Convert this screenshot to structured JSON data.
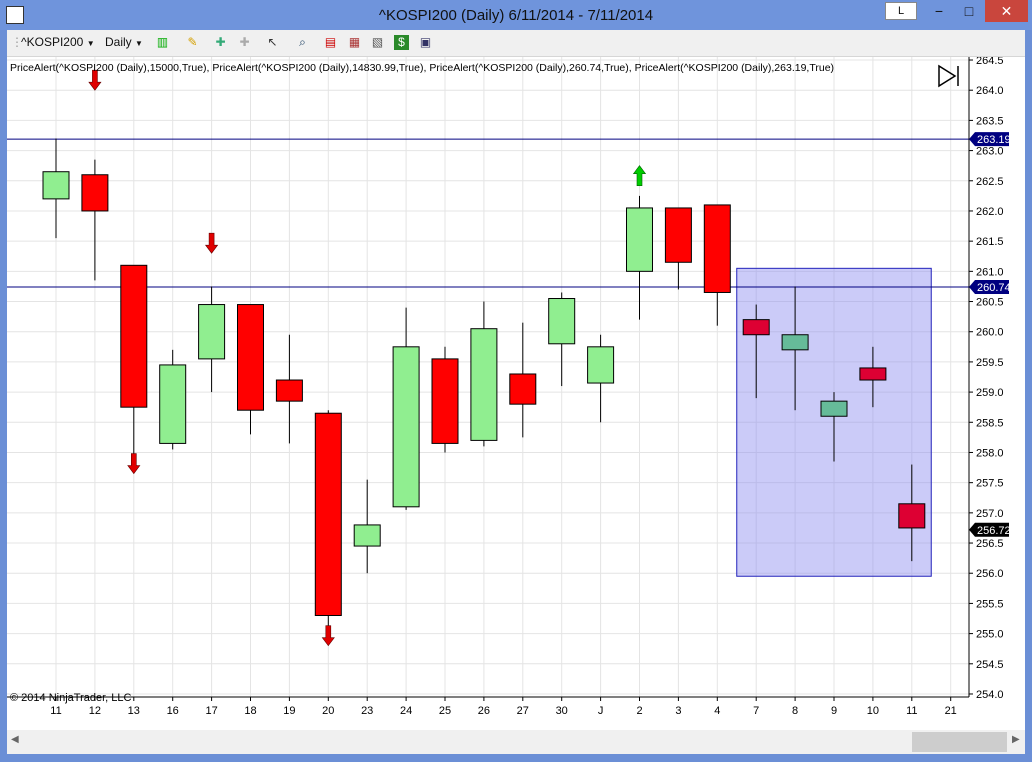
{
  "window": {
    "title": "^KOSPI200 (Daily)  6/11/2014 - 7/11/2014",
    "layout_button": "L",
    "minimize": "−",
    "maximize": "□",
    "close": "✕"
  },
  "toolbar": {
    "instrument": "^KOSPI200",
    "period": "Daily",
    "icons": [
      "bar-chart-icon",
      "pencil-icon",
      "add-indicator-icon",
      "remove-indicator-icon",
      "pointer-icon",
      "zoom-icon",
      "strategies-icon",
      "analyzer-icon",
      "dollar-icon",
      "properties-icon"
    ]
  },
  "indicator_label": "PriceAlert(^KOSPI200 (Daily),15000,True), PriceAlert(^KOSPI200 (Daily),14830.99,True), PriceAlert(^KOSPI200 (Daily),260.74,True), PriceAlert(^KOSPI200 (Daily),263.19,True)",
  "copyright": "© 2014 NinjaTrader, LLC",
  "colors": {
    "up": "#90ee90",
    "down": "#ff0000",
    "up_selected": "#66bb99",
    "down_selected": "#dd0033",
    "alert_line": "#000080",
    "selection_box": "rgba(140,140,240,0.45)"
  },
  "chart_data": {
    "type": "candlestick",
    "y_ticks": [
      "254.0",
      "254.5",
      "255.0",
      "255.5",
      "256.0",
      "256.5",
      "257.0",
      "257.5",
      "258.0",
      "258.5",
      "259.0",
      "259.5",
      "260.0",
      "260.5",
      "261.0",
      "261.5",
      "262.0",
      "262.5",
      "263.0",
      "263.5",
      "264.0",
      "264.5"
    ],
    "ylim": [
      253.95,
      264.55
    ],
    "x_labels": [
      "11",
      "12",
      "13",
      "16",
      "17",
      "18",
      "19",
      "20",
      "23",
      "24",
      "25",
      "26",
      "27",
      "30",
      "J",
      "2",
      "3",
      "4",
      "7",
      "8",
      "9",
      "10",
      "11",
      "21"
    ],
    "candles": [
      {
        "o": 262.2,
        "h": 263.2,
        "l": 261.55,
        "c": 262.65
      },
      {
        "o": 262.6,
        "h": 262.85,
        "l": 260.85,
        "c": 262.0
      },
      {
        "o": 261.1,
        "h": 261.1,
        "l": 257.9,
        "c": 258.75
      },
      {
        "o": 258.15,
        "h": 259.7,
        "l": 258.05,
        "c": 259.45
      },
      {
        "o": 259.55,
        "h": 260.75,
        "l": 259.0,
        "c": 260.45
      },
      {
        "o": 260.45,
        "h": 260.45,
        "l": 258.3,
        "c": 258.7
      },
      {
        "o": 259.2,
        "h": 259.95,
        "l": 258.15,
        "c": 258.85
      },
      {
        "o": 258.65,
        "h": 258.7,
        "l": 255.05,
        "c": 255.3
      },
      {
        "o": 256.45,
        "h": 257.55,
        "l": 256.0,
        "c": 256.8
      },
      {
        "o": 257.1,
        "h": 260.4,
        "l": 257.05,
        "c": 259.75
      },
      {
        "o": 259.55,
        "h": 259.75,
        "l": 258.0,
        "c": 258.15
      },
      {
        "o": 258.2,
        "h": 260.5,
        "l": 258.1,
        "c": 260.05
      },
      {
        "o": 259.3,
        "h": 260.15,
        "l": 258.25,
        "c": 258.8
      },
      {
        "o": 259.8,
        "h": 260.65,
        "l": 259.1,
        "c": 260.55
      },
      {
        "o": 259.15,
        "h": 259.95,
        "l": 258.5,
        "c": 259.75
      },
      {
        "o": 261.0,
        "h": 262.25,
        "l": 260.2,
        "c": 262.05
      },
      {
        "o": 262.05,
        "h": 262.05,
        "l": 260.7,
        "c": 261.15
      },
      {
        "o": 262.1,
        "h": 262.1,
        "l": 260.1,
        "c": 260.65
      },
      {
        "o": 260.2,
        "h": 260.45,
        "l": 258.9,
        "c": 259.95
      },
      {
        "o": 259.7,
        "h": 260.75,
        "l": 258.7,
        "c": 259.95
      },
      {
        "o": 258.6,
        "h": 259.0,
        "l": 257.85,
        "c": 258.85
      },
      {
        "o": 259.4,
        "h": 259.75,
        "l": 258.75,
        "c": 259.2
      },
      {
        "o": 257.15,
        "h": 257.8,
        "l": 256.2,
        "c": 256.75
      }
    ],
    "alert_lines": [
      {
        "value": 263.19,
        "label": "263.19"
      },
      {
        "value": 260.74,
        "label": "260.74"
      }
    ],
    "last_price_label": "256.72",
    "last_price": 256.72,
    "selection": {
      "from_index": 18,
      "to_index": 22,
      "top": 261.05,
      "bottom": 255.95
    },
    "down_arrows": [
      {
        "index": 1,
        "value": 264.0
      },
      {
        "index": 2,
        "value": 257.65
      },
      {
        "index": 4,
        "value": 261.3
      },
      {
        "index": 7,
        "value": 254.8
      }
    ],
    "up_arrows": [
      {
        "index": 15,
        "value": 262.75
      }
    ]
  }
}
